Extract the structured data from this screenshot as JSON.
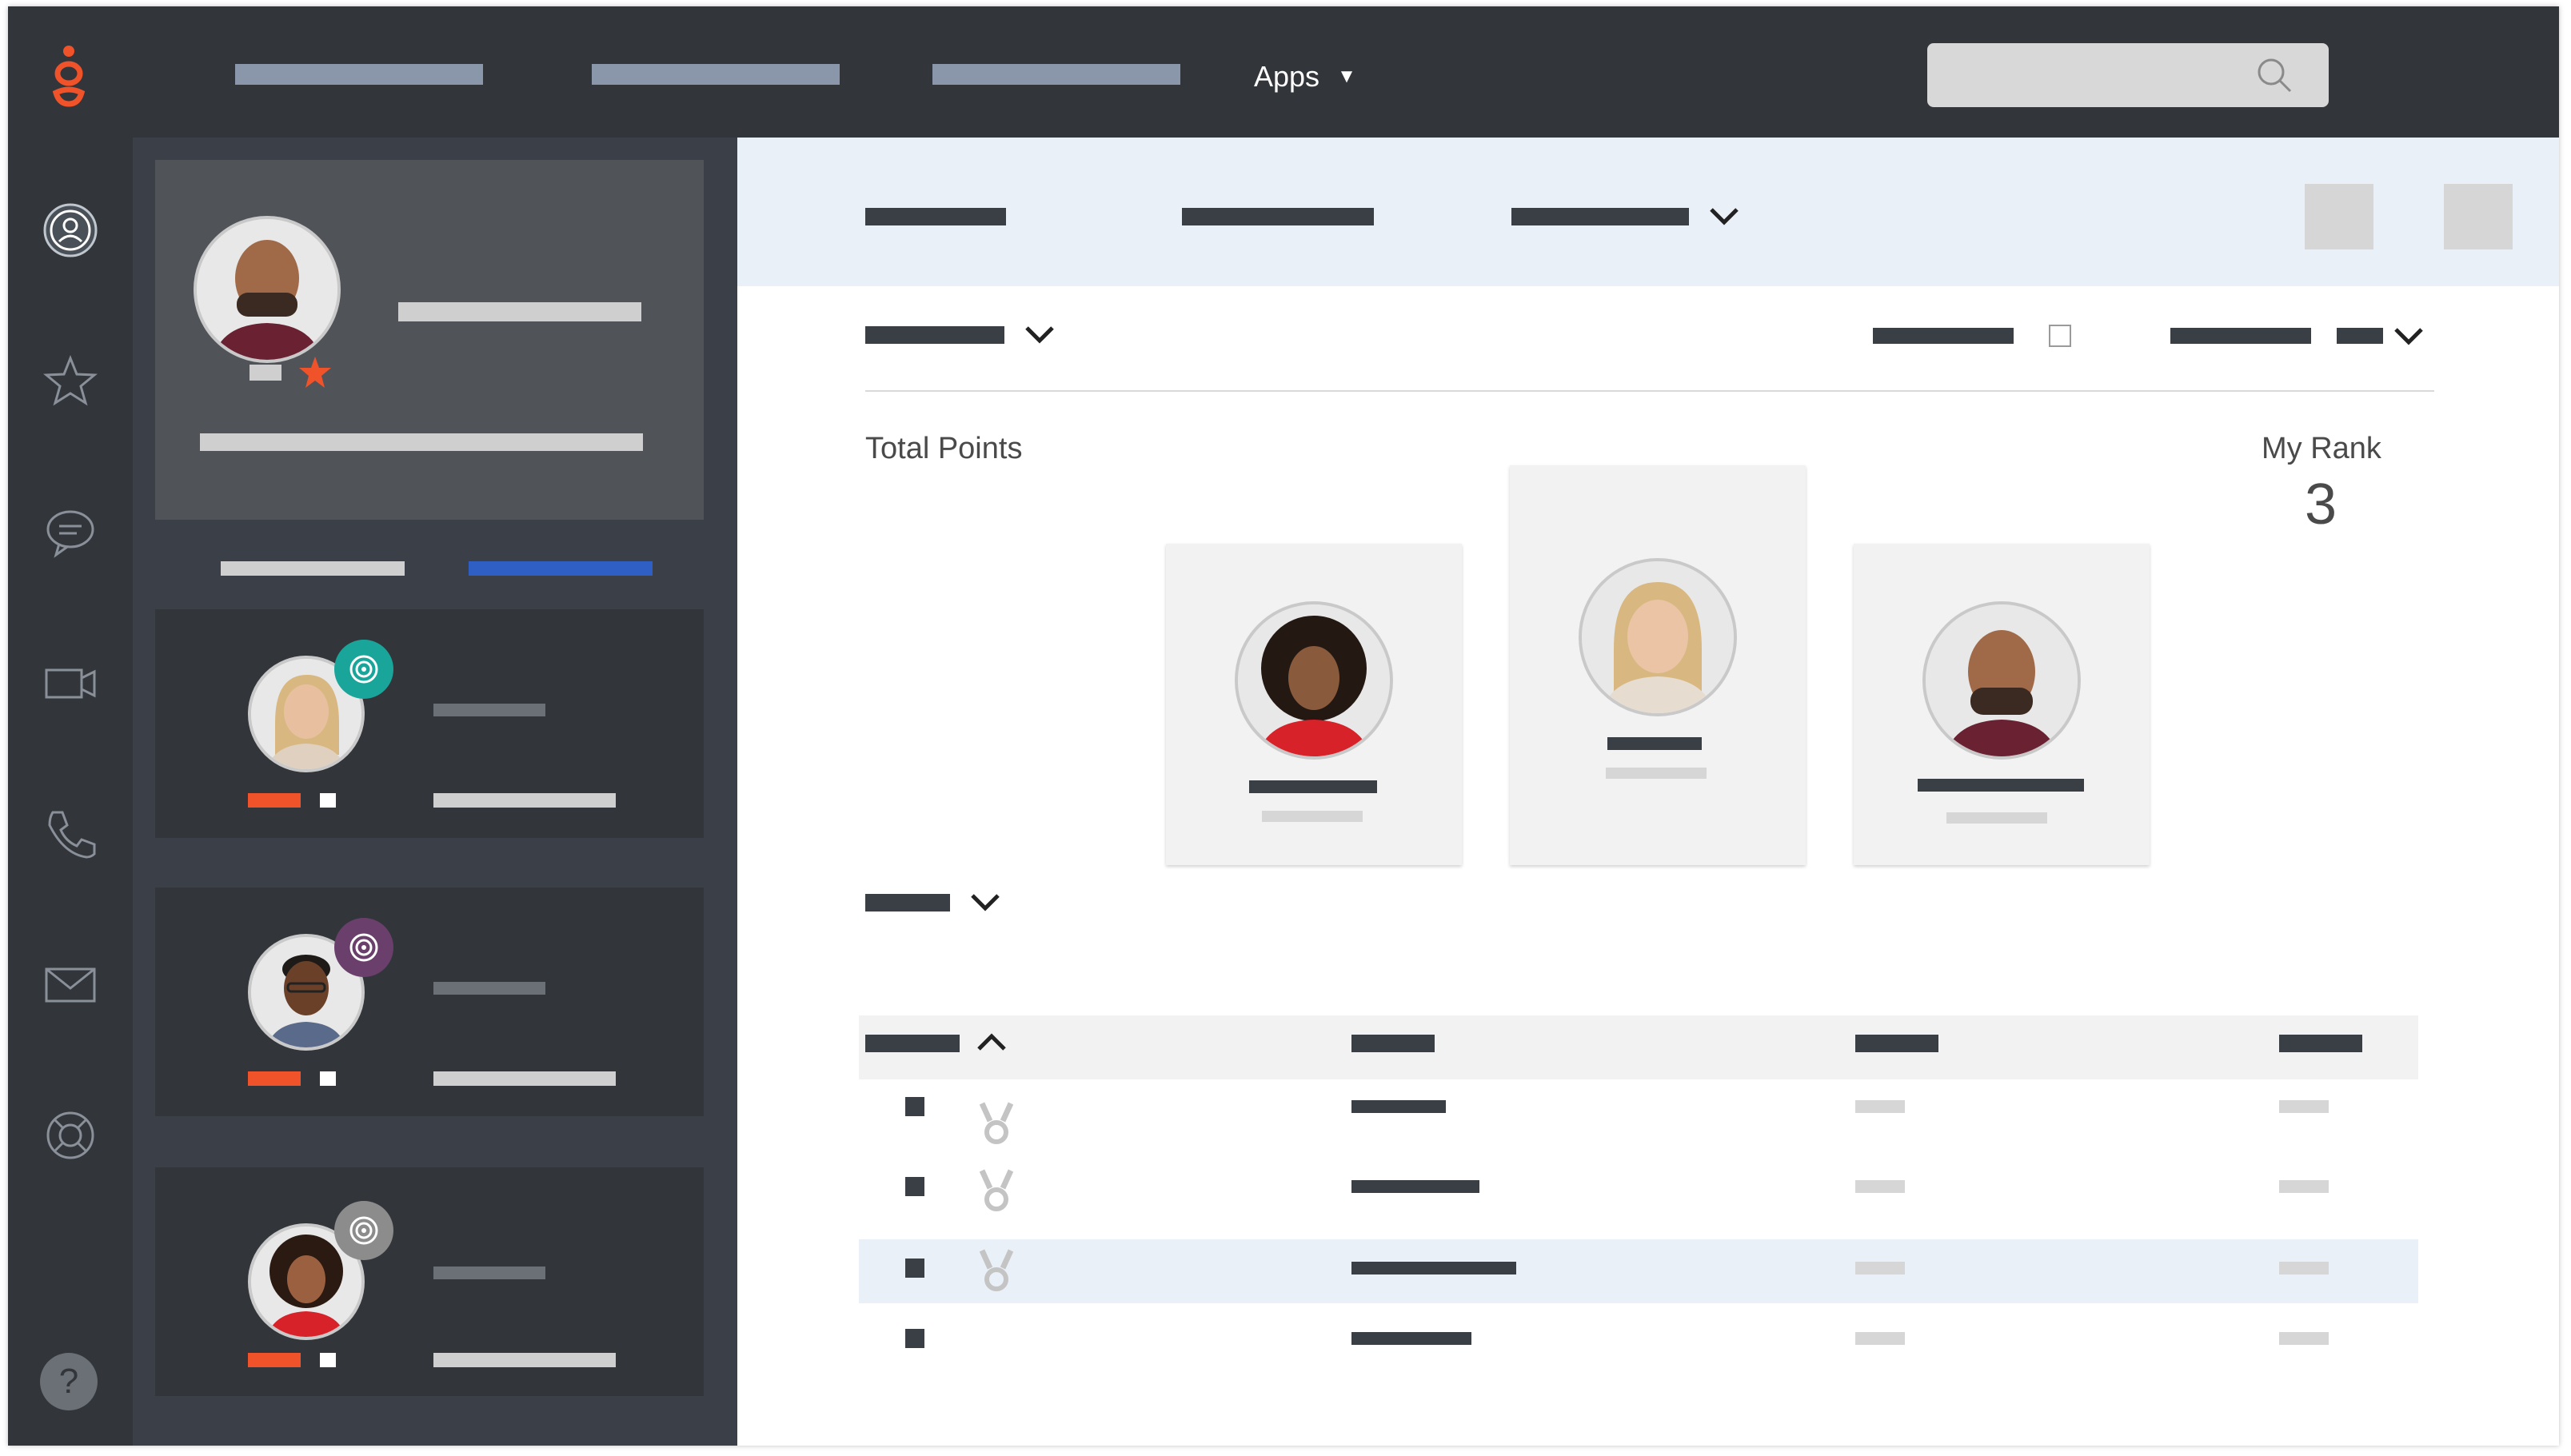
{
  "topbar": {
    "apps_label": "Apps",
    "apps_caret": "▼",
    "search_icon": "search-icon",
    "logo_icon": "genesys-logo-icon"
  },
  "rail": {
    "items": [
      {
        "name": "profile-icon",
        "active": true
      },
      {
        "name": "star-icon"
      },
      {
        "name": "chat-icon"
      },
      {
        "name": "video-icon"
      },
      {
        "name": "phone-icon"
      },
      {
        "name": "mail-icon"
      },
      {
        "name": "lifebuoy-icon"
      }
    ],
    "help_label": "?"
  },
  "profile": {
    "favorite_icon": "star-icon"
  },
  "team": [
    {
      "badge_color": "#1aa59b",
      "badge_icon": "target-icon"
    },
    {
      "badge_color": "#6b3f6b",
      "badge_icon": "target-icon"
    },
    {
      "badge_color": "#8c8c8c",
      "badge_icon": "target-icon"
    }
  ],
  "leaderboard": {
    "total_points_label": "Total Points",
    "my_rank_label": "My Rank",
    "my_rank_value": "3"
  },
  "colors": {
    "topbar": "#32363b",
    "accent_orange": "#f0532a",
    "accent_blue": "#2f5fc4",
    "subheader_bg": "#eaf0f8"
  }
}
